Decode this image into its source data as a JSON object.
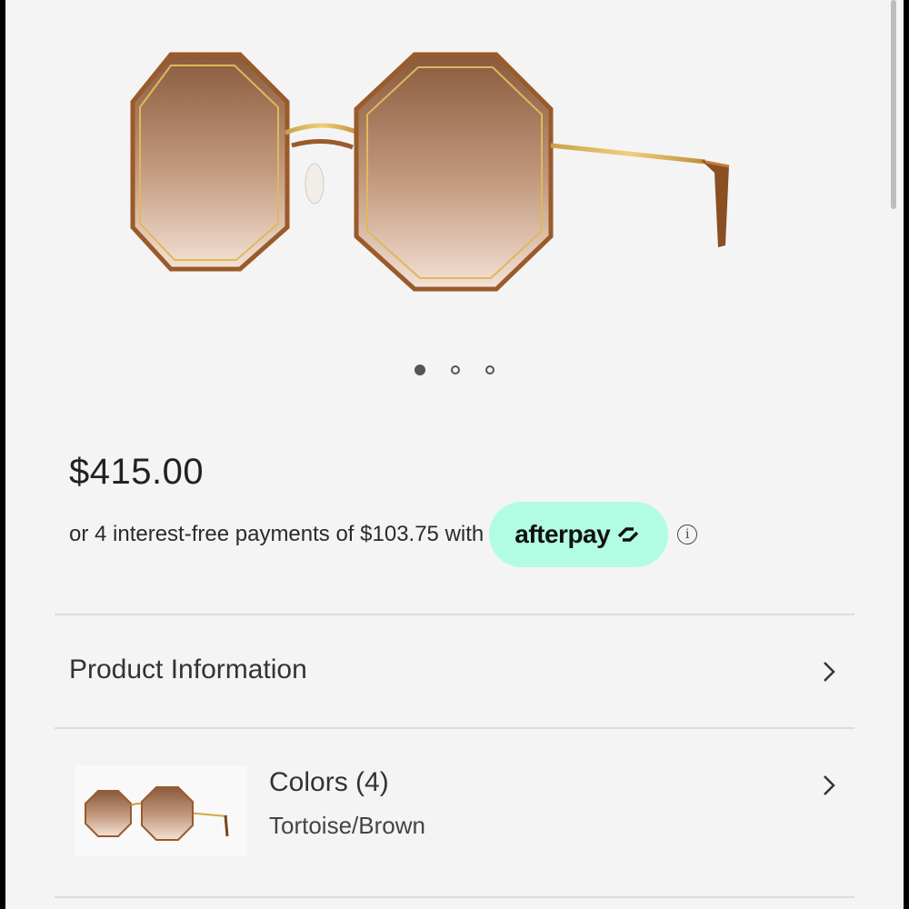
{
  "product": {
    "price": "$415.00",
    "installment_text": "or 4 interest-free payments of $103.75 with",
    "afterpay_brand": "afterpay",
    "info_icon": "info-icon",
    "image_carousel": {
      "count": 3,
      "active_index": 0
    }
  },
  "sections": {
    "product_information_label": "Product Information",
    "colors_label": "Colors (4)",
    "selected_color": "Tortoise/Brown"
  },
  "colors": {
    "screen_bg": "#f4f4f4",
    "afterpay_mint": "#b2fce4",
    "text_dark": "#222222",
    "divider": "#dcdcdc"
  }
}
